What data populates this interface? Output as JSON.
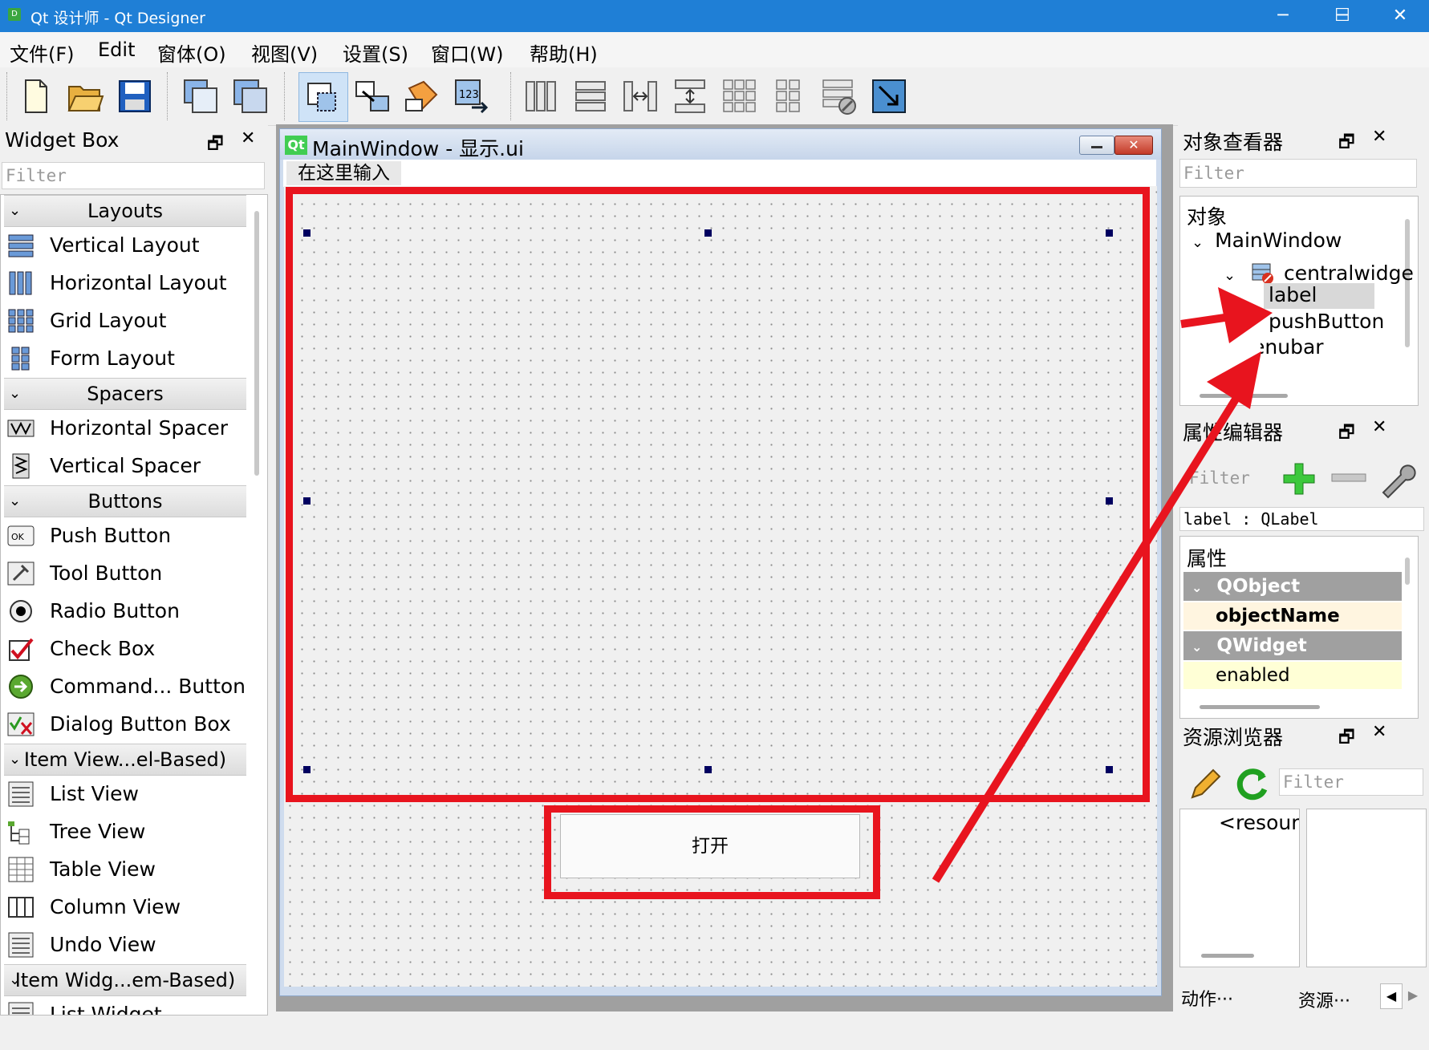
{
  "window": {
    "title": "Qt 设计师 - Qt Designer",
    "app_icon_text": "D",
    "minimize": "─",
    "maximize": "☐",
    "close": "✕"
  },
  "menu": [
    "文件(F)",
    "Edit",
    "窗体(O)",
    "视图(V)",
    "设置(S)",
    "窗口(W)",
    "帮助(H)"
  ],
  "widget_box": {
    "title": "Widget Box",
    "filter_placeholder": "Filter",
    "categories": [
      {
        "name": "Layouts",
        "items": [
          "Vertical Layout",
          "Horizontal Layout",
          "Grid Layout",
          "Form Layout"
        ]
      },
      {
        "name": "Spacers",
        "items": [
          "Horizontal Spacer",
          "Vertical Spacer"
        ]
      },
      {
        "name": "Buttons",
        "items": [
          "Push Button",
          "Tool Button",
          "Radio Button",
          "Check Box",
          "Command... Button",
          "Dialog Button Box"
        ]
      },
      {
        "name": "Item View...el-Based)",
        "items": [
          "List View",
          "Tree View",
          "Table View",
          "Column View",
          "Undo View"
        ]
      },
      {
        "name": "Item Widg...em-Based)",
        "items": [
          "List Widget"
        ]
      }
    ]
  },
  "form": {
    "title": "MainWindow - 显示.ui",
    "qt_badge": "Qt",
    "menu_placeholder": "在这里输入",
    "button_text": "打开"
  },
  "object_inspector": {
    "title": "对象查看器",
    "filter_placeholder": "Filter",
    "column_header": "对象",
    "tree": [
      "MainWindow",
      "centralwidge",
      "label",
      "pushButton",
      "enubar"
    ]
  },
  "property_editor": {
    "title": "属性编辑器",
    "filter_placeholder": "Filter",
    "selected_object": "label : QLabel",
    "column_header": "属性",
    "rows": [
      {
        "type": "group",
        "text": "QObject"
      },
      {
        "type": "prop",
        "text": "objectName"
      },
      {
        "type": "group",
        "text": "QWidget"
      },
      {
        "type": "prop",
        "text": "enabled"
      }
    ]
  },
  "resource_browser": {
    "title": "资源浏览器",
    "filter_placeholder": "Filter",
    "tree_item": "<resourc",
    "tabs": [
      "动作···",
      "资源···"
    ]
  },
  "colors": {
    "titlebar": "#1f7fd6",
    "annotation_red": "#e8141e",
    "selection_handle": "#000060",
    "prop_group": "#a0a0a0",
    "prop_name_bg": "#fff5e0",
    "prop_enabled_bg": "#ffffd6"
  },
  "icons": {
    "toolbar": [
      "new-file-icon",
      "open-folder-icon",
      "save-icon",
      "cascade-windows-icon",
      "tile-windows-icon",
      "edit-widgets-icon",
      "edit-signals-slots-icon",
      "edit-buddies-icon",
      "edit-tab-order-icon",
      "layout-horizontal-icon",
      "layout-vertical-icon",
      "layout-horizontal-splitter-icon",
      "layout-vertical-splitter-icon",
      "layout-grid-icon",
      "layout-form-icon",
      "break-layout-icon",
      "adjust-size-icon"
    ]
  }
}
